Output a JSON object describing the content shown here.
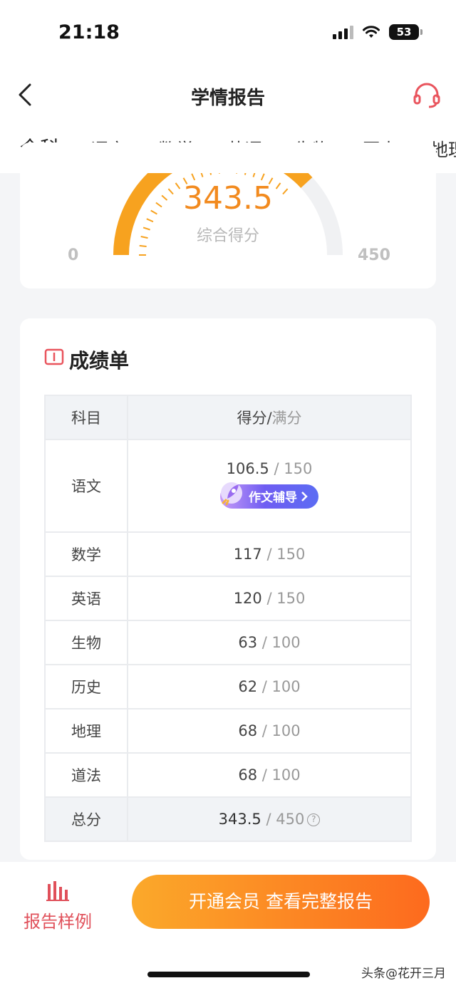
{
  "status_bar": {
    "time": "21:18",
    "battery": "53"
  },
  "navbar": {
    "title": "学情报告"
  },
  "tabs": [
    "全科",
    "语文",
    "数学",
    "英语",
    "生物",
    "历史",
    "地理"
  ],
  "gauge": {
    "score": "343.5",
    "label": "综合得分",
    "min": "0",
    "max": "450",
    "fraction": 0.763
  },
  "scores_card": {
    "title": "成绩单",
    "header_subject": "科目",
    "header_score": "得分",
    "header_slash": "/",
    "header_full": "满分",
    "essay_button": "作文辅导",
    "rows": [
      {
        "subject": "语文",
        "score": "106.5",
        "full": "150"
      },
      {
        "subject": "数学",
        "score": "117",
        "full": "150"
      },
      {
        "subject": "英语",
        "score": "120",
        "full": "150"
      },
      {
        "subject": "生物",
        "score": "63",
        "full": "100"
      },
      {
        "subject": "历史",
        "score": "62",
        "full": "100"
      },
      {
        "subject": "地理",
        "score": "68",
        "full": "100"
      },
      {
        "subject": "道法",
        "score": "68",
        "full": "100"
      }
    ],
    "total": {
      "subject": "总分",
      "score": "343.5",
      "full": "450"
    },
    "slash": " / "
  },
  "bottom": {
    "sample_label": "报告样例",
    "vip_button": "开通会员 查看完整报告"
  },
  "watermark": "头条@花开三月",
  "colors": {
    "accent_orange": "#f28a1e",
    "accent_red": "#e0505a",
    "essay_purple": "#6f5df2"
  }
}
